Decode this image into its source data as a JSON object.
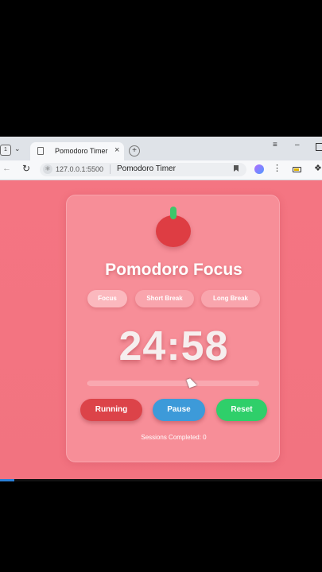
{
  "browser": {
    "tab_count": "1",
    "tab_title": "Pomodoro Timer",
    "url": "127.0.0.1:5500",
    "page_title": "Pomodoro Timer"
  },
  "app": {
    "title": "Pomodoro Focus",
    "modes": [
      {
        "label": "Focus",
        "active": true
      },
      {
        "label": "Short Break",
        "active": false
      },
      {
        "label": "Long Break",
        "active": false
      }
    ],
    "timer": "24:58",
    "progress": 0.0013,
    "buttons": {
      "running": "Running",
      "pause": "Pause",
      "reset": "Reset"
    },
    "sessions": "Sessions Completed: 0"
  },
  "colors": {
    "background": "#f47582",
    "card": "#f78e98",
    "tomato": "#de3d43",
    "stem": "#3ec76a",
    "running_button": "#dc4349",
    "pause_button": "#3d9ad9",
    "reset_button": "#2fcf6a"
  },
  "icons": [
    "page-icon",
    "close-icon",
    "plus-icon",
    "back-arrow-icon",
    "reload-icon",
    "site-info-icon",
    "bookmark-icon",
    "copilot-icon",
    "menu-icon",
    "battery-icon",
    "extensions-icon",
    "tomato-icon"
  ]
}
